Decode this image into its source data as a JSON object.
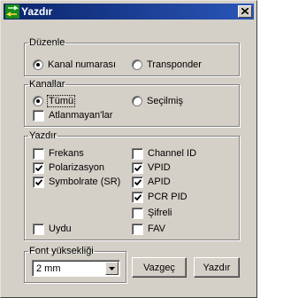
{
  "window": {
    "title": "Yazdır"
  },
  "duzenle": {
    "legend": "Düzenle",
    "options": [
      "Kanal numarası",
      "Transponder"
    ],
    "selected": "Kanal numarası"
  },
  "kanallar": {
    "legend": "Kanallar",
    "all_label": "Tümü",
    "selected_label": "Seçilmiş",
    "selected": "Tümü",
    "skip_label": "Atlanmayan'lar",
    "skip_checked": false
  },
  "yazdir": {
    "legend": "Yazdır",
    "left": [
      {
        "label": "Frekans",
        "checked": false
      },
      {
        "label": "Polarizasyon",
        "checked": true
      },
      {
        "label": "Symbolrate (SR)",
        "checked": true
      },
      {
        "label": "Uydu",
        "checked": false
      }
    ],
    "right": [
      {
        "label": "Channel ID",
        "checked": false
      },
      {
        "label": "VPID",
        "checked": true
      },
      {
        "label": "APID",
        "checked": true
      },
      {
        "label": "PCR PID",
        "checked": true
      },
      {
        "label": "Şifreli",
        "checked": false
      },
      {
        "label": "FAV",
        "checked": false
      }
    ]
  },
  "font": {
    "legend": "Font yüksekliği",
    "value": "2 mm"
  },
  "buttons": {
    "cancel": "Vazgeç",
    "print": "Yazdır"
  },
  "colors": {
    "titlebar": "#0a246a",
    "face": "#d4d0c8"
  },
  "icons": {
    "app": "green-arrows-icon",
    "close": "close-icon",
    "dropdown": "chevron-down-icon"
  }
}
